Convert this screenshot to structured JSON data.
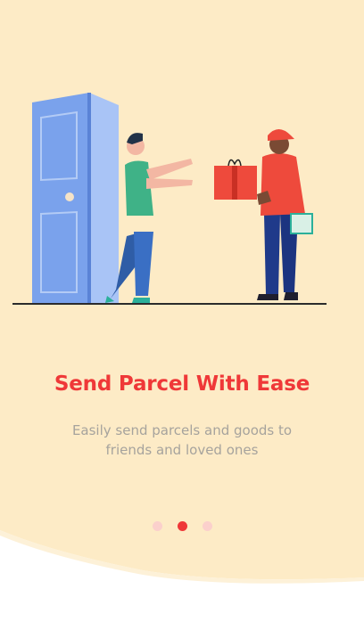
{
  "onboarding": {
    "title": "Send Parcel With Ease",
    "description": "Easily send parcels and goods to friends and loved ones",
    "illustration_icon": "delivery-handover-illustration",
    "pagination": {
      "count": 3,
      "active_index": 1
    }
  },
  "colors": {
    "background": "#fdebc6",
    "accent": "#ef3838",
    "inactive_dot": "#fbd0cc",
    "subtitle_text": "#a6a39d"
  }
}
